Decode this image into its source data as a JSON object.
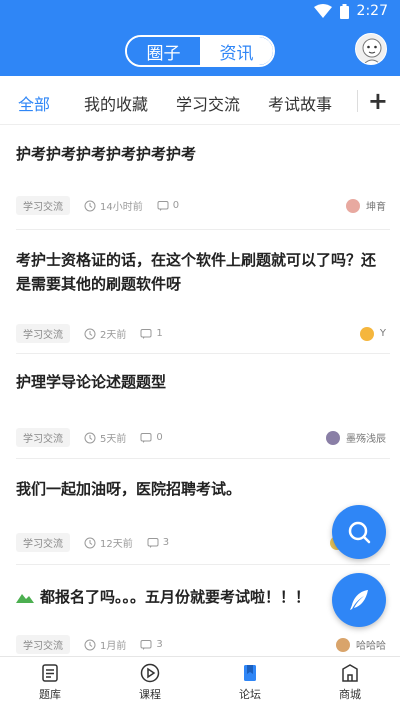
{
  "status": {
    "time": "2:27"
  },
  "header": {
    "seg_active": "圈子",
    "seg_inactive": "资讯"
  },
  "tabs": {
    "items": [
      "全部",
      "我的收藏",
      "学习交流",
      "考试故事"
    ],
    "plus": "+"
  },
  "posts": [
    {
      "title": "护考护考护考护考护考护考",
      "tag": "学习交流",
      "time": "14小时前",
      "comments": "0",
      "author": "坤育"
    },
    {
      "title": "考护士资格证的话，在这个软件上刷题就可以了吗？还是需要其他的刷题软件呀",
      "tag": "学习交流",
      "time": "2天前",
      "comments": "1",
      "author": "Y"
    },
    {
      "title": "护理学导论论述题题型",
      "tag": "学习交流",
      "time": "5天前",
      "comments": "0",
      "author": "墨殇浅辰"
    },
    {
      "title": "我们一起加油呀，医院招聘考试。",
      "tag": "学习交流",
      "time": "12天前",
      "comments": "3",
      "author": ""
    },
    {
      "title": "都报名了吗。。。五月份就要考试啦！！！",
      "tag": "学习交流",
      "time": "1月前",
      "comments": "3",
      "author": "哈哈哈"
    }
  ],
  "bottom_nav": {
    "items": [
      "题库",
      "课程",
      "论坛",
      "商城"
    ]
  },
  "colors": {
    "primary": "#2f86f6"
  }
}
